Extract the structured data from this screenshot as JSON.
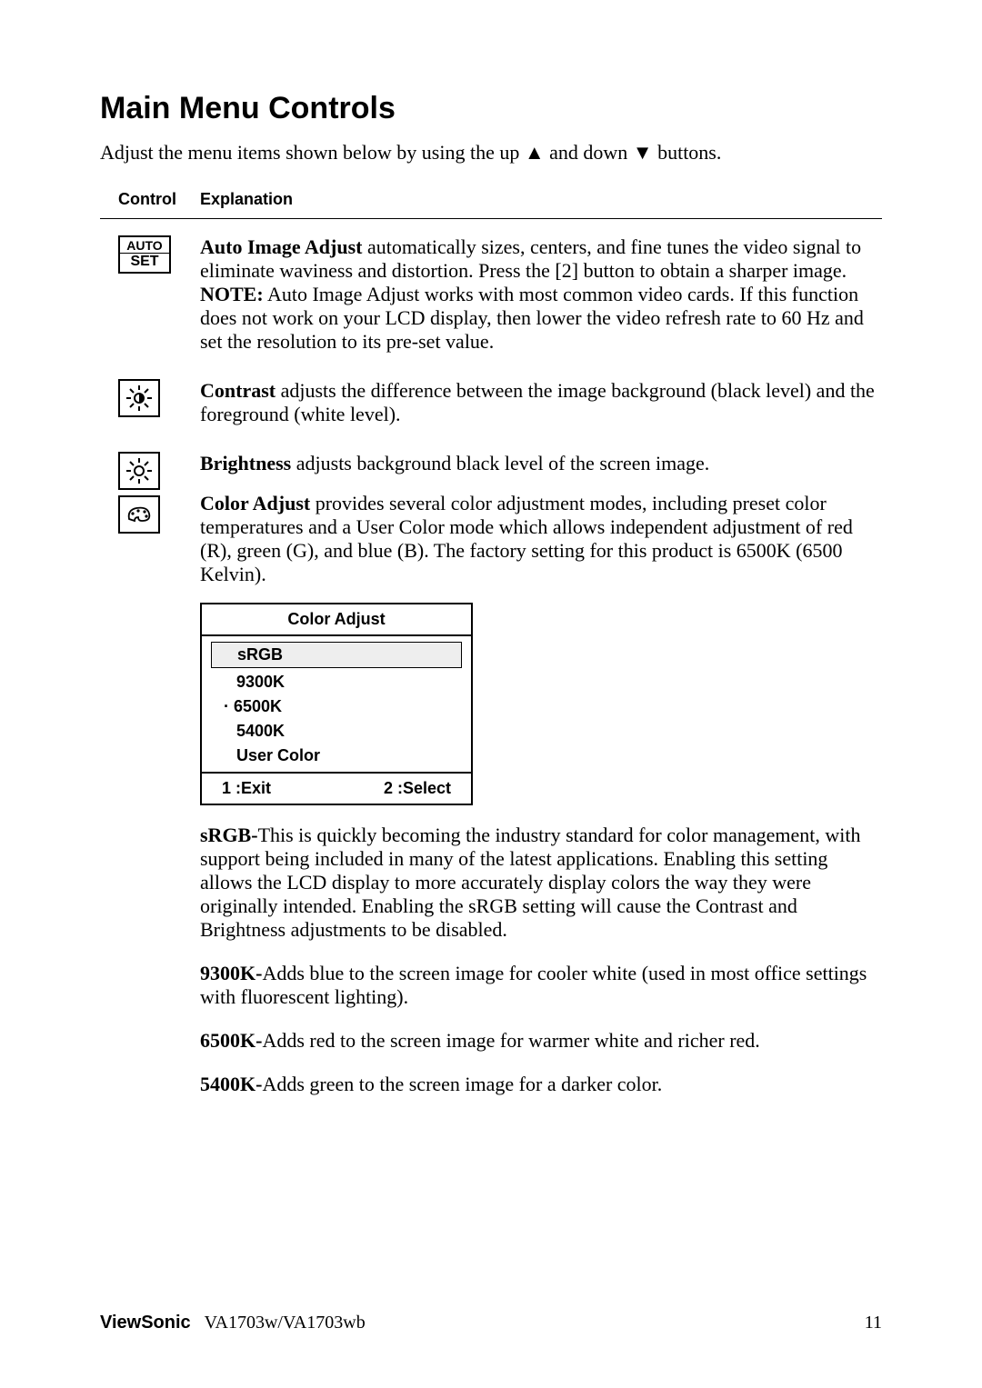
{
  "heading": "Main Menu Controls",
  "intro_pre": "Adjust the menu items shown below by using the up ",
  "intro_mid": " and down ",
  "intro_post": " buttons.",
  "headers": {
    "control": "Control",
    "explanation": "Explanation"
  },
  "auto": {
    "icon_line1": "AUTO",
    "icon_line2": "SET",
    "title": "Auto Image Adjust",
    "body": " automatically sizes, centers, and fine tunes the video signal to eliminate waviness and distortion. Press the [2] button to obtain a sharper image.",
    "note_label": "NOTE:",
    "note_body": " Auto Image Adjust works with most common video cards. If this function does not work on your LCD display, then lower the video refresh rate to 60 Hz and set the resolution to its pre-set value."
  },
  "contrast": {
    "title": "Contrast",
    "body": " adjusts the difference between the image background  (black level) and the foreground (white level)."
  },
  "brightness": {
    "title": "Brightness",
    "body": " adjusts background black level of the screen image."
  },
  "coloradjust": {
    "title": "Color Adjust",
    "body": " provides several color adjustment modes, including preset color temperatures and a User Color mode which allows independent adjustment of red (R), green (G), and blue (B). The factory setting for this product is 6500K (6500 Kelvin)."
  },
  "ca_menu": {
    "title": "Color Adjust",
    "items": [
      "sRGB",
      "9300K",
      "· 6500K",
      "5400K",
      "User Color"
    ],
    "exit": "1 :Exit",
    "select": "2 :Select"
  },
  "srgb": {
    "title": "sRGB-",
    "body": "This is quickly becoming the industry standard for color management, with support being included in many of the latest applications. Enabling this setting allows the LCD display to more accurately display colors the way they were originally intended. Enabling the sRGB setting will cause the Contrast and Brightness adjustments to be disabled."
  },
  "k9300": {
    "title": "9300K-",
    "body": "Adds blue to the screen image for cooler white (used in most office settings with fluorescent lighting)."
  },
  "k6500": {
    "title": "6500K-",
    "body": "Adds red to the screen image for warmer white and richer red."
  },
  "k5400": {
    "title": "5400K-",
    "body": "Adds green to the screen image for a darker color."
  },
  "footer": {
    "brand": "ViewSonic",
    "model": "VA1703w/VA1703wb",
    "page": "11"
  }
}
